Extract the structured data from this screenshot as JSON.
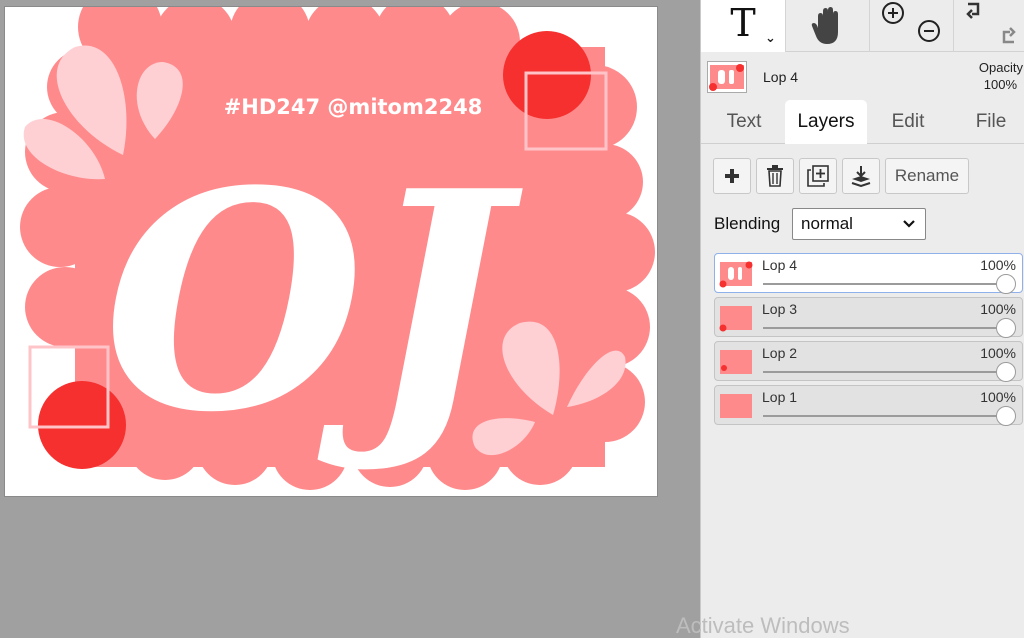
{
  "canvas": {
    "handle": "#HD247 @mitom2248",
    "logo_text": "OJ",
    "colors": {
      "background": "#ffffff",
      "blob": "#ff8a8c",
      "accent": "#f5302f",
      "petal": "#ffd0d3",
      "frame": "#ffc4c7",
      "letter": "#ffffff"
    }
  },
  "toolbar": {
    "text_tool_glyph": "T",
    "text_tool_caret": "⌄",
    "tools": [
      "text-tool-icon",
      "hand-icon",
      "zoom-in-icon",
      "zoom-out-icon",
      "undo-icon",
      "redo-icon"
    ]
  },
  "current_layer": {
    "name": "Lop 4",
    "opacity_label": "Opacity",
    "opacity_value": "100%"
  },
  "tabs": [
    {
      "label": "Text"
    },
    {
      "label": "Layers"
    },
    {
      "label": "Edit"
    },
    {
      "label": "File"
    }
  ],
  "layer_tools": {
    "rename_label": "Rename",
    "icons": [
      "plus-icon",
      "trash-icon",
      "duplicate-icon",
      "merge-down-icon"
    ]
  },
  "blending": {
    "label": "Blending",
    "value": "normal"
  },
  "layers": [
    {
      "name": "Lop 4",
      "opacity": "100%"
    },
    {
      "name": "Lop 3",
      "opacity": "100%"
    },
    {
      "name": "Lop 2",
      "opacity": "100%"
    },
    {
      "name": "Lop 1",
      "opacity": "100%"
    }
  ],
  "watermark": "Activate Windows"
}
